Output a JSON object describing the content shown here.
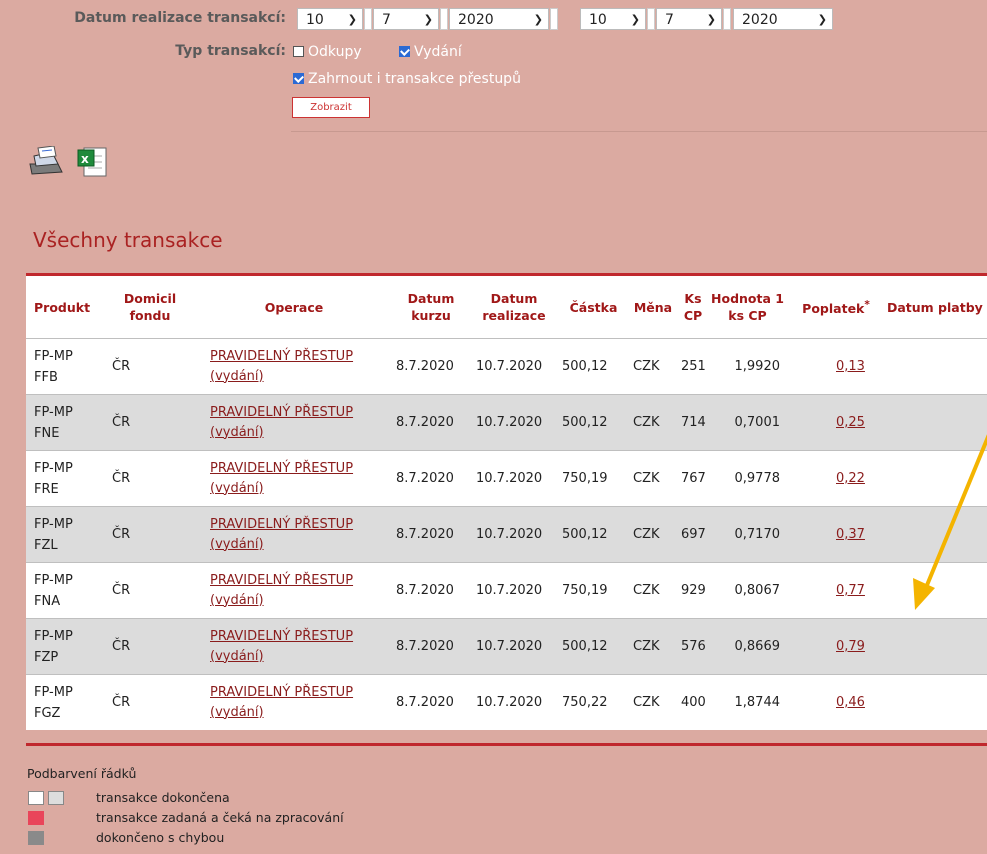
{
  "filters": {
    "date_label": "Datum realizace transakcí:",
    "date_from": {
      "day": "10",
      "month": "7",
      "year": "2020"
    },
    "date_to": {
      "day": "10",
      "month": "7",
      "year": "2020"
    },
    "type_label": "Typ transakcí:",
    "cb_odkupy": "Odkupy",
    "cb_vydani": "Vydání",
    "cb_prestupy": "Zahrnout i transakce přestupů",
    "show_button": "Zobrazit"
  },
  "section_title": "Všechny transakce",
  "table": {
    "headers": {
      "produkt": "Produkt",
      "domicil": "Domicil fondu",
      "operace": "Operace",
      "datum_kurzu": "Datum kurzu",
      "datum_realizace": "Datum realizace",
      "castka": "Částka",
      "mena": "Měna",
      "ks": "Ks CP",
      "hodnota": "Hodnota 1 ks CP",
      "poplatek": "Poplatek",
      "poplatek_mark": "*",
      "datum_platby": "Datum platby"
    },
    "rows": [
      {
        "produkt": "FP-MP FFB",
        "domicil": "ČR",
        "operace": "PRAVIDELNÝ PŘESTUP",
        "operace_sub": "(vydání)",
        "kurz": "8.7.2020",
        "realizace": "10.7.2020",
        "castka": "500,12",
        "mena": "CZK",
        "ks": "251",
        "hodnota": "1,9920",
        "poplatek": "0,13"
      },
      {
        "produkt": "FP-MP FNE",
        "domicil": "ČR",
        "operace": "PRAVIDELNÝ PŘESTUP",
        "operace_sub": "(vydání)",
        "kurz": "8.7.2020",
        "realizace": "10.7.2020",
        "castka": "500,12",
        "mena": "CZK",
        "ks": "714",
        "hodnota": "0,7001",
        "poplatek": "0,25"
      },
      {
        "produkt": "FP-MP FRE",
        "domicil": "ČR",
        "operace": "PRAVIDELNÝ PŘESTUP",
        "operace_sub": "(vydání)",
        "kurz": "8.7.2020",
        "realizace": "10.7.2020",
        "castka": "750,19",
        "mena": "CZK",
        "ks": "767",
        "hodnota": "0,9778",
        "poplatek": "0,22"
      },
      {
        "produkt": "FP-MP FZL",
        "domicil": "ČR",
        "operace": "PRAVIDELNÝ PŘESTUP",
        "operace_sub": "(vydání)",
        "kurz": "8.7.2020",
        "realizace": "10.7.2020",
        "castka": "500,12",
        "mena": "CZK",
        "ks": "697",
        "hodnota": "0,7170",
        "poplatek": "0,37"
      },
      {
        "produkt": "FP-MP FNA",
        "domicil": "ČR",
        "operace": "PRAVIDELNÝ PŘESTUP",
        "operace_sub": "(vydání)",
        "kurz": "8.7.2020",
        "realizace": "10.7.2020",
        "castka": "750,19",
        "mena": "CZK",
        "ks": "929",
        "hodnota": "0,8067",
        "poplatek": "0,77"
      },
      {
        "produkt": "FP-MP FZP",
        "domicil": "ČR",
        "operace": "PRAVIDELNÝ PŘESTUP",
        "operace_sub": "(vydání)",
        "kurz": "8.7.2020",
        "realizace": "10.7.2020",
        "castka": "500,12",
        "mena": "CZK",
        "ks": "576",
        "hodnota": "0,8669",
        "poplatek": "0,79"
      },
      {
        "produkt": "FP-MP FGZ",
        "domicil": "ČR",
        "operace": "PRAVIDELNÝ PŘESTUP",
        "operace_sub": "(vydání)",
        "kurz": "8.7.2020",
        "realizace": "10.7.2020",
        "castka": "750,22",
        "mena": "CZK",
        "ks": "400",
        "hodnota": "1,8744",
        "poplatek": "0,46"
      }
    ]
  },
  "legend": {
    "title": "Podbarvení řádků",
    "completed": "transakce dokončena",
    "pending": "transakce zadaná a čeká na zpracování",
    "error": "dokončeno s chybou"
  },
  "colors": {
    "background": "#dbaaa1",
    "accent_red": "#c0282d",
    "link": "#8a1c1c",
    "annotation_arrow": "#f4b400"
  },
  "icons": [
    "printer-icon",
    "excel-icon"
  ]
}
